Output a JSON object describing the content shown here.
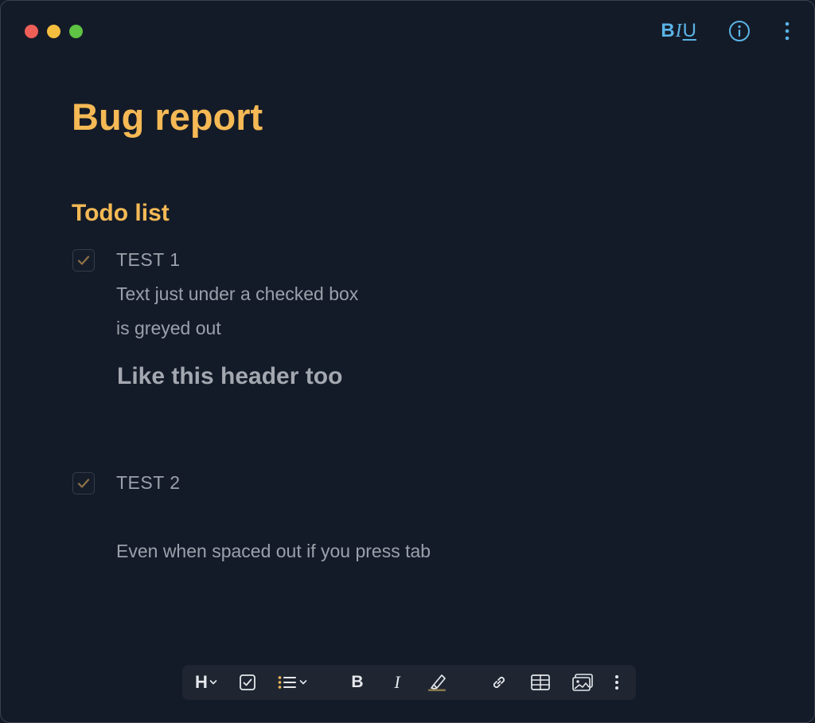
{
  "window": {
    "traffic_lights": {
      "close": "#ee5f57",
      "minimize": "#f5be3f",
      "zoom": "#5fc344"
    }
  },
  "top_bar": {
    "format_bold": "B",
    "format_italic": "I",
    "format_underline": "U",
    "info_icon": "info-icon",
    "more_icon": "more-vertical-icon",
    "accent_color": "#5ab4e6"
  },
  "document": {
    "title": "Bug report",
    "heading": "Todo list",
    "tasks": [
      {
        "label": "TEST 1",
        "checked": true
      },
      {
        "label": "TEST 2",
        "checked": true
      }
    ],
    "greyed_lines": [
      "Text just under a checked box",
      "is greyed out"
    ],
    "greyed_header": "Like this header too",
    "tab_text": "Even when spaced out if you press tab",
    "accent_color": "#f5b955"
  },
  "toolbar": {
    "heading_label": "H",
    "bold_label": "B",
    "italic_label": "I",
    "items": [
      "heading-dropdown",
      "checkbox-icon",
      "list-dropdown",
      "bold",
      "italic",
      "highlighter-icon",
      "link-icon",
      "table-icon",
      "image-icon",
      "more-icon"
    ]
  }
}
